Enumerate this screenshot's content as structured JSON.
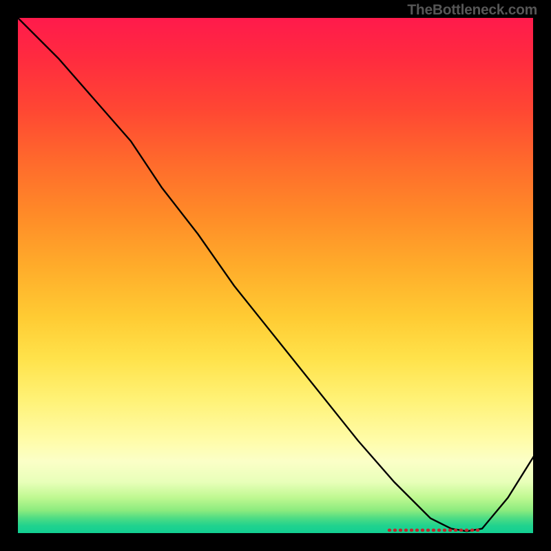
{
  "watermark": "TheBottleneck.com",
  "colors": {
    "curve": "#000000",
    "dotted": "#c1272d"
  },
  "chart_data": {
    "type": "line",
    "title": "",
    "xlabel": "",
    "ylabel": "",
    "xlim": [
      0,
      100
    ],
    "ylim": [
      0,
      100
    ],
    "grid": false,
    "legend": false,
    "series": [
      {
        "name": "black-curve",
        "x": [
          0,
          8,
          15,
          22,
          28,
          35,
          42,
          50,
          58,
          66,
          73,
          80,
          84,
          87,
          90,
          95,
          100
        ],
        "y": [
          100,
          92,
          84,
          76,
          67,
          58,
          48,
          38,
          28,
          18,
          10,
          3,
          1,
          0.5,
          1,
          7,
          15
        ]
      },
      {
        "name": "red-dotted-bottom",
        "x": [
          72,
          90
        ],
        "y": [
          0.7,
          0.7
        ]
      }
    ]
  }
}
